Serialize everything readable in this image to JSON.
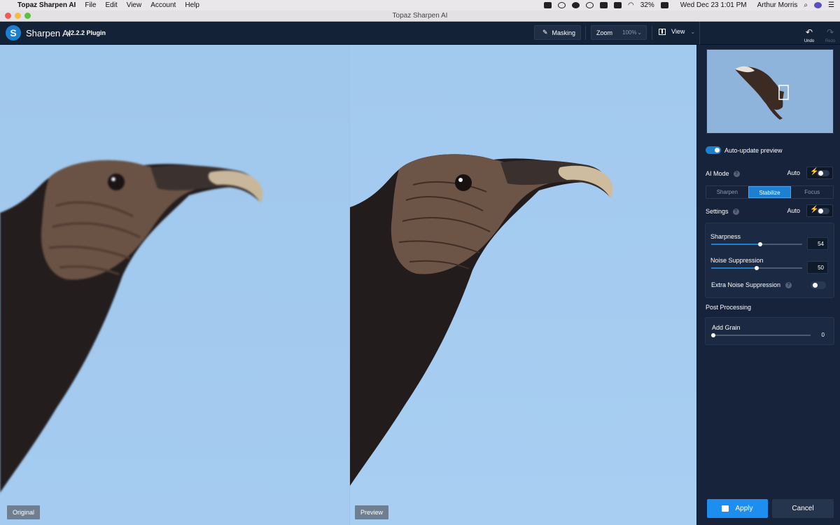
{
  "menubar": {
    "app_name": "Topaz Sharpen AI",
    "items": [
      "File",
      "Edit",
      "View",
      "Account",
      "Help"
    ],
    "battery": "32%",
    "datetime": "Wed Dec 23  1:01 PM",
    "user": "Arthur Morris"
  },
  "window": {
    "title": "Topaz Sharpen AI"
  },
  "toolbar": {
    "logo_letter": "S",
    "app_title": "Sharpen AI",
    "version": "v2.2.2 Plugin",
    "masking_label": "Masking",
    "zoom_label": "Zoom",
    "zoom_value": "100%",
    "view_label": "View",
    "undo_label": "Undo",
    "redo_label": "Redo"
  },
  "canvas": {
    "original_label": "Original",
    "preview_label": "Preview"
  },
  "sidebar": {
    "auto_update_label": "Auto-update preview",
    "auto_update_on": true,
    "ai_mode_label": "AI Mode",
    "ai_mode_auto_label": "Auto",
    "modes": [
      "Sharpen",
      "Stabilize",
      "Focus"
    ],
    "active_mode": "Stabilize",
    "settings_label": "Settings",
    "settings_auto_label": "Auto",
    "sharpness": {
      "label": "Sharpness",
      "value": "54",
      "fraction": 0.54
    },
    "noise": {
      "label": "Noise Suppression",
      "value": "50",
      "fraction": 0.5
    },
    "extra_noise_label": "Extra Noise Suppression",
    "post_processing_label": "Post Processing",
    "grain": {
      "label": "Add Grain",
      "value": "0",
      "fraction": 0
    },
    "apply_label": "Apply",
    "cancel_label": "Cancel"
  },
  "colors": {
    "accent": "#1d8ef0",
    "panel_bg": "#16233a",
    "sky": "#a1c9ee"
  }
}
